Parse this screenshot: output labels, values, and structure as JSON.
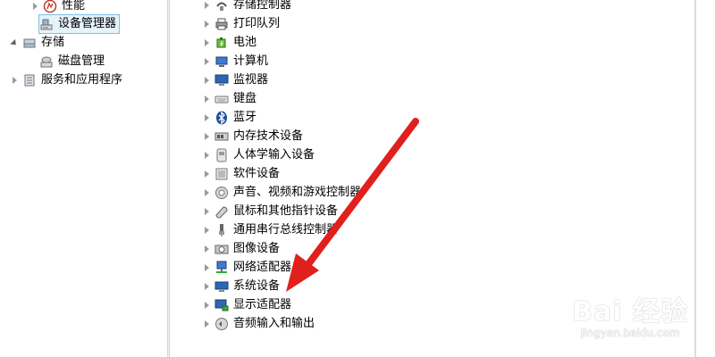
{
  "left_tree": {
    "items": [
      {
        "label": "性能",
        "icon": "performance-icon"
      },
      {
        "label": "设备管理器",
        "icon": "device-manager-icon",
        "selected": true
      },
      {
        "label": "存储",
        "icon": "storage-icon"
      },
      {
        "label": "磁盘管理",
        "icon": "disk-management-icon"
      },
      {
        "label": "服务和应用程序",
        "icon": "services-apps-icon"
      }
    ]
  },
  "device_tree": {
    "items": [
      {
        "label": "存储控制器",
        "icon": "storage-controller-icon"
      },
      {
        "label": "打印队列",
        "icon": "printer-icon"
      },
      {
        "label": "电池",
        "icon": "battery-icon"
      },
      {
        "label": "计算机",
        "icon": "computer-icon"
      },
      {
        "label": "监视器",
        "icon": "monitor-icon"
      },
      {
        "label": "键盘",
        "icon": "keyboard-icon"
      },
      {
        "label": "蓝牙",
        "icon": "bluetooth-icon"
      },
      {
        "label": "内存技术设备",
        "icon": "memory-device-icon"
      },
      {
        "label": "人体学输入设备",
        "icon": "hid-icon"
      },
      {
        "label": "软件设备",
        "icon": "software-device-icon"
      },
      {
        "label": "声音、视频和游戏控制器",
        "icon": "sound-icon"
      },
      {
        "label": "鼠标和其他指针设备",
        "icon": "mouse-icon"
      },
      {
        "label": "通用串行总线控制器",
        "icon": "usb-icon"
      },
      {
        "label": "图像设备",
        "icon": "camera-icon"
      },
      {
        "label": "网络适配器",
        "icon": "network-adapter-icon"
      },
      {
        "label": "系统设备",
        "icon": "system-device-icon"
      },
      {
        "label": "显示适配器",
        "icon": "display-adapter-icon"
      },
      {
        "label": "音频输入和输出",
        "icon": "audio-io-icon"
      }
    ]
  },
  "watermark": {
    "brand": "Bai 经验",
    "url": "jingyan.baidu.com"
  },
  "colors": {
    "selection_bg": "#e5f3fb",
    "selection_border": "#7fc0e5",
    "arrow": "#e0201c"
  }
}
